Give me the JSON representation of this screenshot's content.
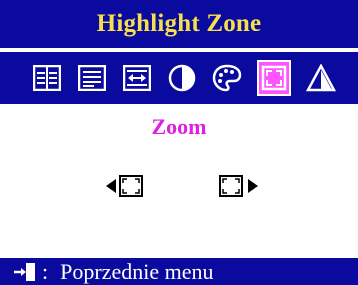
{
  "title": "Highlight Zone",
  "tabs": [
    {
      "name": "tab-layout-1",
      "icon": "panel-split-icon",
      "selected": false
    },
    {
      "name": "tab-layout-2",
      "icon": "text-lines-icon",
      "selected": false
    },
    {
      "name": "tab-layout-3",
      "icon": "fit-arrows-icon",
      "selected": false
    },
    {
      "name": "tab-contrast",
      "icon": "contrast-icon",
      "selected": false
    },
    {
      "name": "tab-color",
      "icon": "palette-icon",
      "selected": false
    },
    {
      "name": "tab-zoom",
      "icon": "zoom-frame-icon",
      "selected": true
    },
    {
      "name": "tab-sharpness",
      "icon": "triangle-icon",
      "selected": false
    }
  ],
  "content": {
    "label": "Zoom"
  },
  "footer": {
    "separator": ":",
    "label": "Poprzednie menu"
  },
  "colors": {
    "bar": "#0a0a9e",
    "title": "#f6e04a",
    "accent": "#e020e0",
    "selected_tab": "#ff55ff"
  }
}
